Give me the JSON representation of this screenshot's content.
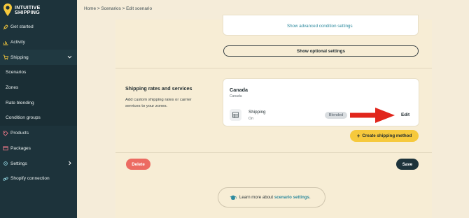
{
  "brand": {
    "line1": "INTUITIVE",
    "line2": "SHIPPING"
  },
  "breadcrumb": {
    "home": "Home",
    "sep1": ">",
    "scenarios": "Scenarios",
    "sep2": ">",
    "current": "Edit scenario"
  },
  "sidebar": {
    "items": [
      {
        "label": "Get started",
        "icon": "rocket-icon"
      },
      {
        "label": "Activity",
        "icon": "activity-icon"
      },
      {
        "label": "Shipping",
        "icon": "cart-icon"
      },
      {
        "label": "Scenarios"
      },
      {
        "label": "Zones"
      },
      {
        "label": "Rate blending"
      },
      {
        "label": "Condition groups"
      },
      {
        "label": "Products",
        "icon": "tag-icon"
      },
      {
        "label": "Packages",
        "icon": "package-icon"
      },
      {
        "label": "Settings",
        "icon": "gear-icon"
      },
      {
        "label": "Shopify connection",
        "icon": "link-icon"
      }
    ]
  },
  "conditions": {
    "advanced_link": "Show advanced condition settings"
  },
  "optional": {
    "button_label": "Show optional settings"
  },
  "rates": {
    "title": "Shipping rates and services",
    "description": "Add custom shipping rates or carrier services to your zones.",
    "zone_name": "Canada",
    "zone_sub": "Canada",
    "method_name": "Shipping",
    "method_status": "On",
    "badge": "Blended",
    "edit_label": "Edit",
    "create_label": "Create shipping method"
  },
  "actions": {
    "delete_label": "Delete",
    "save_label": "Save"
  },
  "learn": {
    "prefix": "Learn more about",
    "link": "scenario settings",
    "suffix": "."
  },
  "colors": {
    "sidebar": "#1d333b",
    "accent_yellow": "#f6c93c",
    "delete_red": "#ec6b62",
    "save_dark": "#1d333b",
    "link_teal": "#2d8a9e",
    "arrow_red": "#e1261c"
  }
}
